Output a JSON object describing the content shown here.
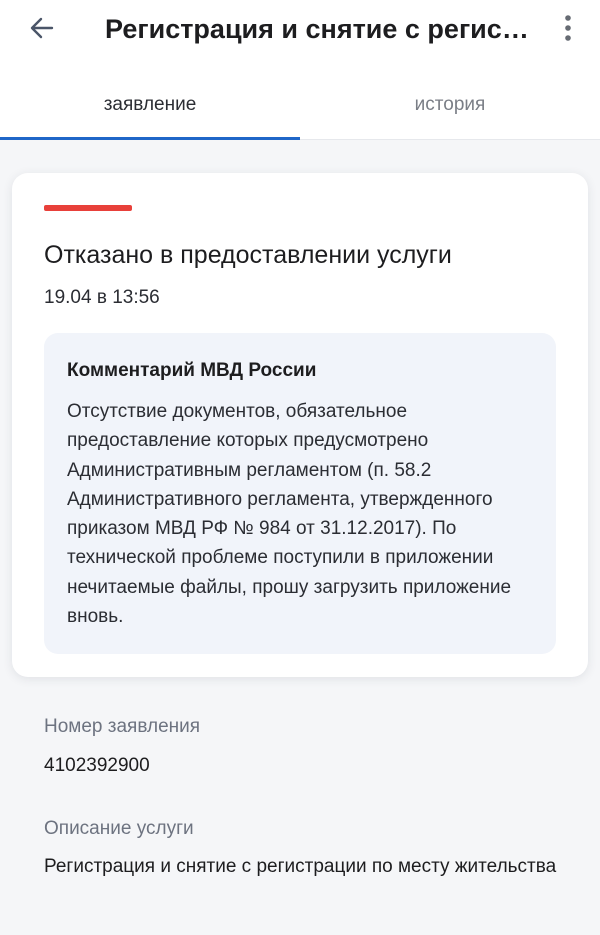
{
  "header": {
    "back_icon": "arrow-left-icon",
    "title": "Регистрация и снятие с регистрации по месту жительства",
    "more_icon": "more-vertical-icon"
  },
  "tabs": [
    {
      "label": "заявление",
      "active": true
    },
    {
      "label": "история",
      "active": false
    }
  ],
  "status_card": {
    "status_color": "#e8403a",
    "status_title": "Отказано в предоставлении услуги",
    "date": "19.04 в 13:56",
    "comment": {
      "title": "Комментарий МВД России",
      "text": "Отсутствие документов, обязательное предоставление которых предусмотрено Административным регламентом (п. 58.2 Административного регламента, утвержденного приказом МВД РФ № 984 от 31.12.2017). По технической проблеме поступили в приложении нечитаемые файлы, прошу загрузить приложение вновь."
    }
  },
  "details": {
    "application_number_label": "Номер заявления",
    "application_number": "4102392900",
    "service_description_label": "Описание услуги",
    "service_description": "Регистрация и снятие с регистрации по месту жительства"
  },
  "colors": {
    "accent": "#1f66c8",
    "error": "#e8403a",
    "muted_text": "#6d7380"
  }
}
